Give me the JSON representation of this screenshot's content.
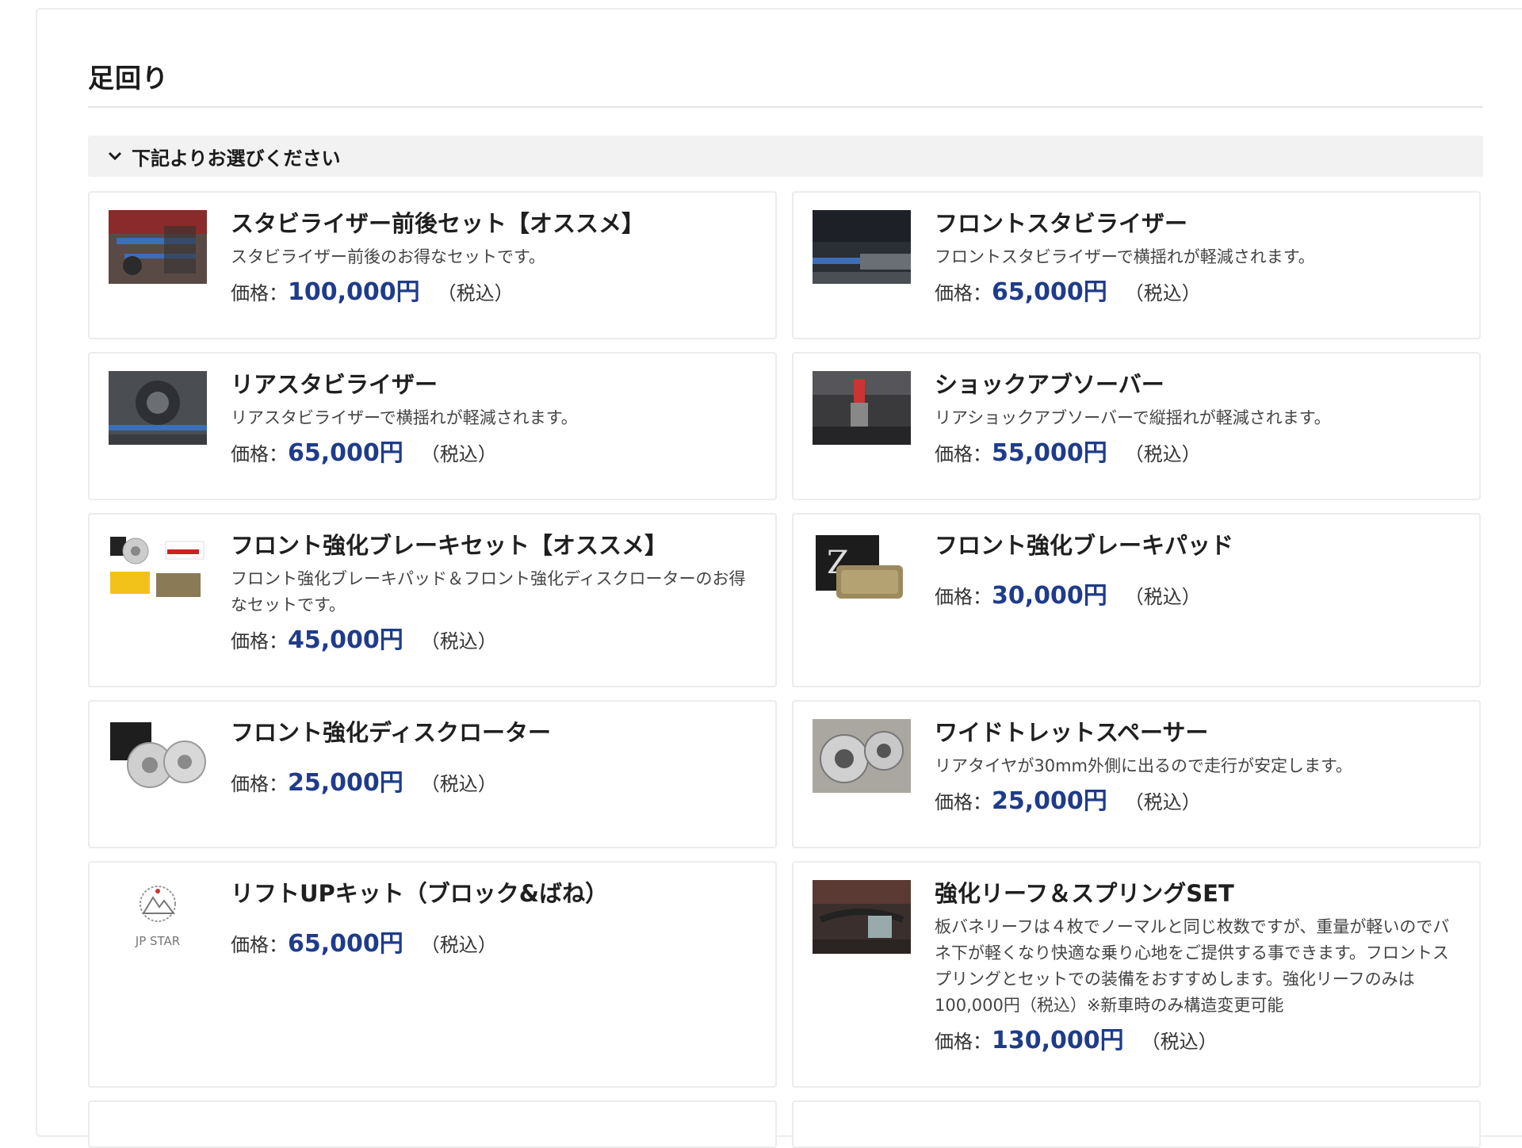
{
  "section": {
    "title": "足回り",
    "selector_label": "下記よりお選びください"
  },
  "price_label": "価格：",
  "tax_label": "（税込）",
  "products": [
    {
      "name": "スタビライザー前後セット【オススメ】",
      "description": "スタビライザー前後のお得なセットです。",
      "price": "100,000円",
      "thumb_icon": "stabilizer-set-photo"
    },
    {
      "name": "フロントスタビライザー",
      "description": "フロントスタビライザーで横揺れが軽減されます。",
      "price": "65,000円",
      "thumb_icon": "front-stabilizer-photo"
    },
    {
      "name": "リアスタビライザー",
      "description": "リアスタビライザーで横揺れが軽減されます。",
      "price": "65,000円",
      "thumb_icon": "rear-stabilizer-photo"
    },
    {
      "name": "ショックアブソーバー",
      "description": "リアショックアブソーバーで縦揺れが軽減されます。",
      "price": "55,000円",
      "thumb_icon": "shock-absorber-photo"
    },
    {
      "name": "フロント強化ブレーキセット【オススメ】",
      "description": "フロント強化ブレーキパッド＆フロント強化ディスクローターのお得なセットです。",
      "price": "45,000円",
      "thumb_icon": "brake-set-photo"
    },
    {
      "name": "フロント強化ブレーキパッド",
      "description": "",
      "price": "30,000円",
      "thumb_icon": "brake-pad-photo"
    },
    {
      "name": "フロント強化ディスクローター",
      "description": "",
      "price": "25,000円",
      "thumb_icon": "disc-rotor-photo"
    },
    {
      "name": "ワイドトレットスペーサー",
      "description": "リアタイヤが30mm外側に出るので走行が安定します。",
      "price": "25,000円",
      "thumb_icon": "wheel-spacer-photo"
    },
    {
      "name": "リフトUPキット（ブロック&ばね）",
      "description": "",
      "price": "65,000円",
      "thumb_icon": "jp-star-logo",
      "logo_text": "JP STAR"
    },
    {
      "name": "強化リーフ＆スプリングSET",
      "description": "板バネリーフは４枚でノーマルと同じ枚数ですが、重量が軽いのでバネ下が軽くなり快適な乗り心地をご提供する事できます。フロントスプリングとセットでの装備をおすすめします。強化リーフのみは100,000円（税込）※新車時のみ構造変更可能",
      "price": "130,000円",
      "thumb_icon": "leaf-spring-photo"
    }
  ],
  "colors": {
    "price_accent": "#1f3c8a",
    "card_border": "#ececec",
    "selector_bg": "#f2f2f2"
  }
}
